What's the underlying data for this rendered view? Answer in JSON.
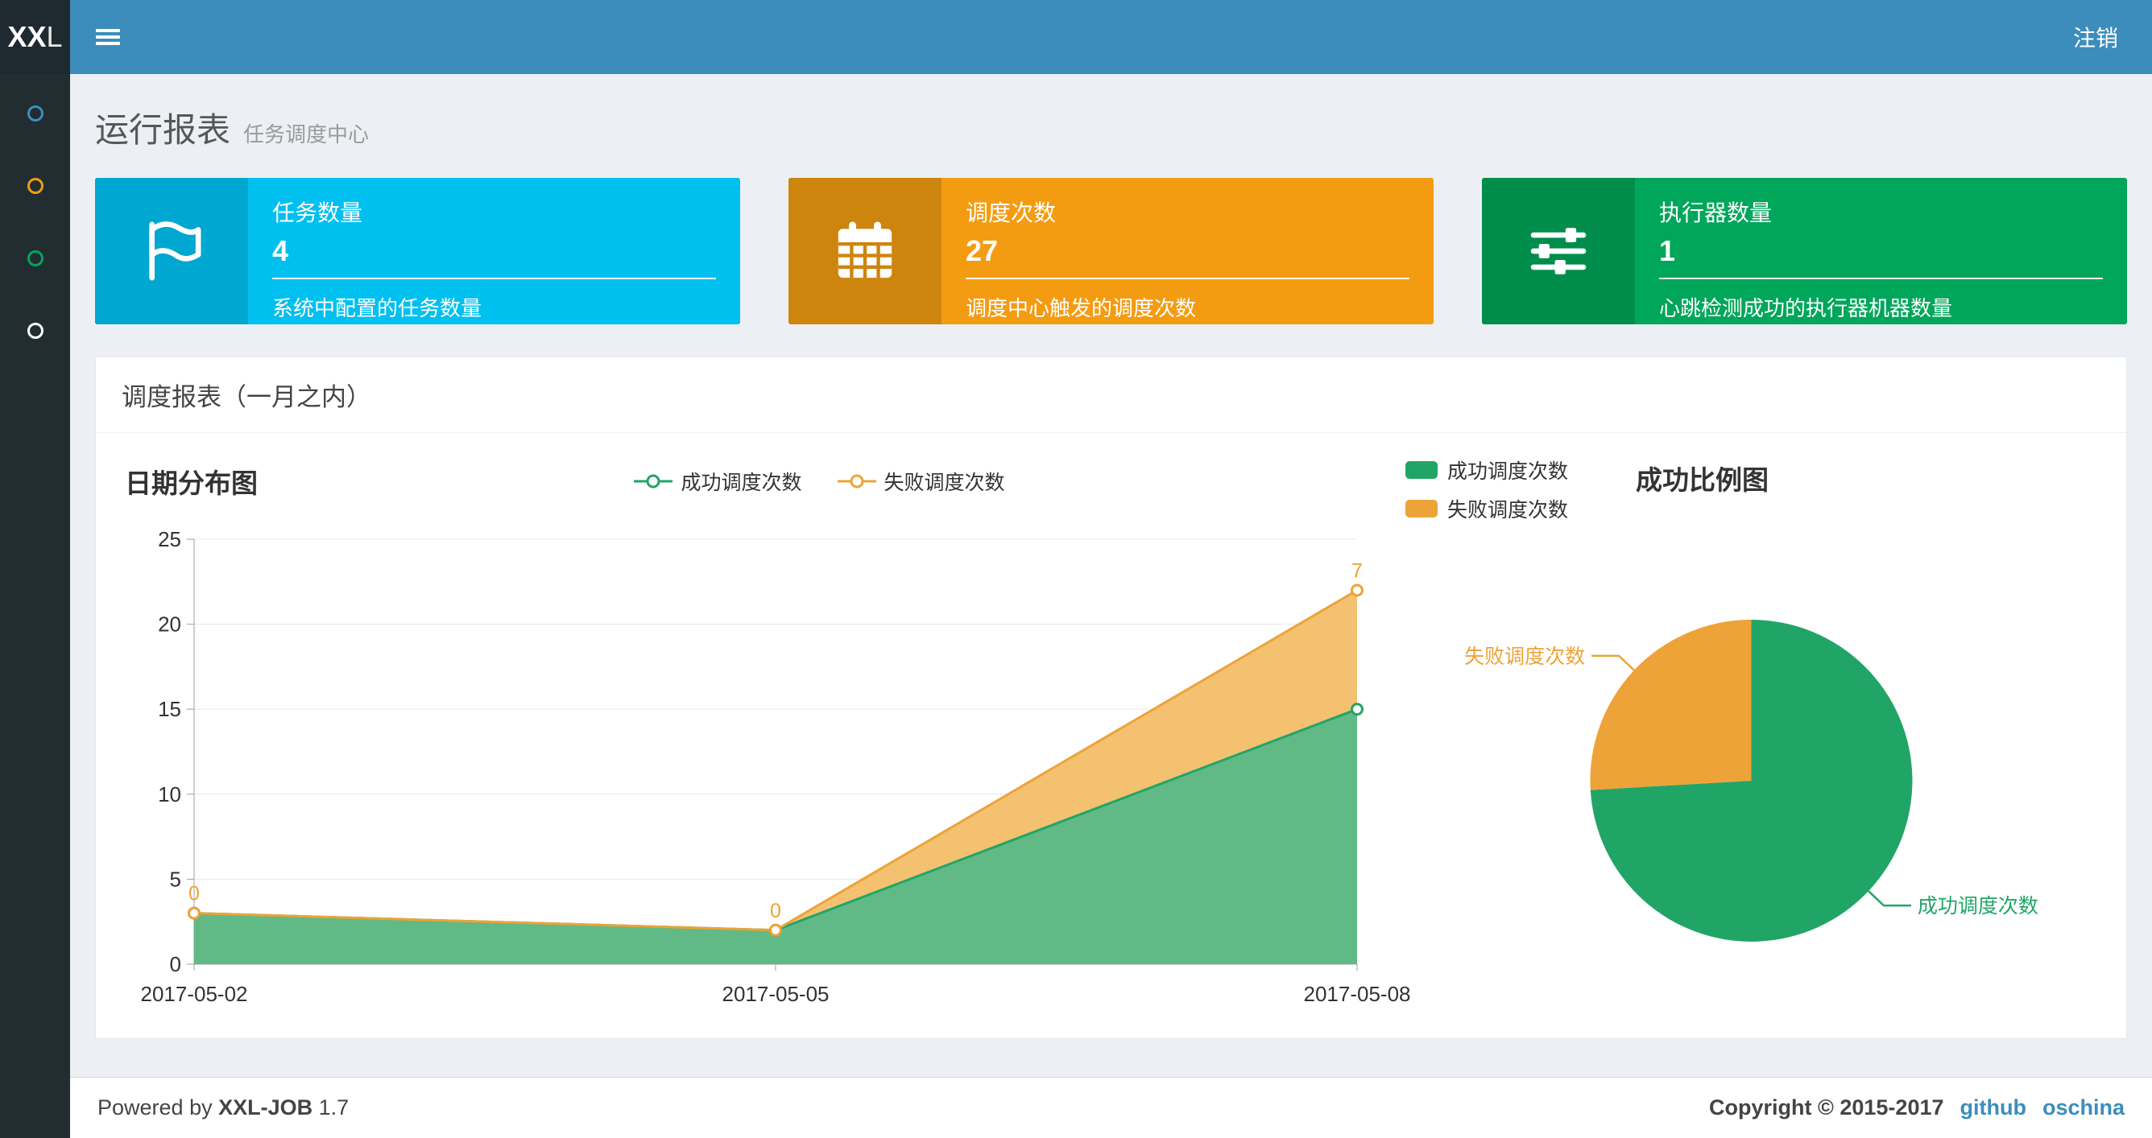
{
  "navbar": {
    "logo_bold": "XX",
    "logo_light": "L",
    "logout_label": "注销",
    "bg_color": "#3c8dbc"
  },
  "sidebar": {
    "items": [
      {
        "icon": "circle-o-icon",
        "color": "#3c8dbc"
      },
      {
        "icon": "circle-o-icon",
        "color": "#f39c12"
      },
      {
        "icon": "circle-o-icon",
        "color": "#00a65a"
      },
      {
        "icon": "circle-o-icon",
        "color": "#ffffff"
      }
    ]
  },
  "page_header": {
    "title": "运行报表",
    "subtitle": "任务调度中心"
  },
  "info_boxes": [
    {
      "title": "任务数量",
      "number": "4",
      "caption": "系统中配置的任务数量",
      "icon": "flag-icon",
      "color": "#00c0ef",
      "icon_bg": "#00a7d0"
    },
    {
      "title": "调度次数",
      "number": "27",
      "caption": "调度中心触发的调度次数",
      "icon": "calendar-icon",
      "color": "#f39c12",
      "icon_bg": "#ce850e"
    },
    {
      "title": "执行器数量",
      "number": "1",
      "caption": "心跳检测成功的执行器机器数量",
      "icon": "sliders-icon",
      "color": "#00a65a",
      "icon_bg": "#008d4c"
    }
  ],
  "panel": {
    "title": "调度报表（一月之内）"
  },
  "chart_data": [
    {
      "type": "area",
      "title": "日期分布图",
      "x": [
        "2017-05-02",
        "2017-05-05",
        "2017-05-08"
      ],
      "series": [
        {
          "name": "成功调度次数",
          "color": "#21a567",
          "fill": "#54b47c",
          "values": [
            3,
            2,
            15
          ]
        },
        {
          "name": "失败调度次数",
          "color": "#eda338",
          "fill": "#f3bc64",
          "values": [
            0,
            0,
            7
          ],
          "stacked": true
        }
      ],
      "point_labels": [
        "0",
        "0",
        "7"
      ],
      "ylim": [
        0,
        25
      ],
      "yticks": [
        0,
        5,
        10,
        15,
        20,
        25
      ],
      "grid": true,
      "legend_position": "top-center"
    },
    {
      "type": "pie",
      "title": "成功比例图",
      "slices": [
        {
          "name": "成功调度次数",
          "color": "#21a567",
          "value": 20
        },
        {
          "name": "失败调度次数",
          "color": "#eda338",
          "value": 7
        }
      ],
      "legend_position": "top-left"
    }
  ],
  "footer": {
    "powered_prefix": "Powered by",
    "product": "XXL-JOB",
    "version": "1.7",
    "copyright": "Copyright © 2015-2017",
    "links": [
      "github",
      "oschina"
    ]
  }
}
